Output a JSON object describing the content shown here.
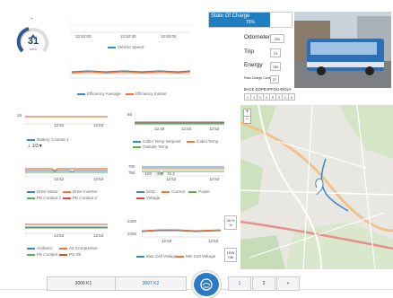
{
  "gauge": {
    "value": "31",
    "unit": "km/h"
  },
  "speed_chart": {
    "ticks": [
      "12:52:00",
      "12:52:30",
      "12:53:00"
    ],
    "legend": "Vehicle Speed"
  },
  "eff_chart": {
    "legend": [
      "Efficiency Average",
      "Efficiency Instant"
    ]
  },
  "soc": {
    "label": "State Of Charge",
    "value": "76%"
  },
  "odometer": {
    "label": "Odometer",
    "value": "200"
  },
  "trip": {
    "label": "Trip",
    "value": "74"
  },
  "energy": {
    "label": "Energy",
    "value": "780"
  },
  "pass_charge": {
    "label": "Pass Charge Current",
    "value": "27"
  },
  "batt": {
    "label": "BACK DOPEAPFOU+ROU+",
    "cells": [
      "1",
      "1",
      "1",
      "1",
      "0",
      "2",
      "1",
      "0"
    ]
  },
  "chart3": {
    "ytick": "18",
    "ticks": [
      "12:52",
      "12:53"
    ],
    "legend": [
      "Battery Coolant 1"
    ],
    "arrows": "⊥ 1/3▼"
  },
  "chart4": {
    "ytick": "50",
    "ticks": [
      "12:48",
      "12:50",
      "12:52"
    ],
    "legend": [
      "Cabin Temp Setpoint",
      "Cabin Temp",
      "Outside Temp"
    ]
  },
  "chart5": {
    "ticks": [
      "12:52",
      "12:53"
    ],
    "legend": [
      "Drive Motor",
      "Drive Inverter",
      "PE Coolant 1",
      "PE Coolant 2"
    ]
  },
  "chart6": {
    "yticks": [
      "700",
      "750"
    ],
    "xticks": [
      "-100",
      "-300",
      "76.2"
    ],
    "ticks": [
      "12:52",
      "12:53"
    ],
    "legend": [
      "SOC",
      "Current",
      "Power",
      "Voltage"
    ]
  },
  "chart7": {
    "ticks": [
      "12:52",
      "12:53"
    ],
    "legend": [
      "Ambient",
      "Air Compressor",
      "PE Coolant",
      "PS Oil"
    ]
  },
  "chart8": {
    "yticks": [
      "2400",
      "2200"
    ],
    "ticks": [
      "12:50",
      "12:52"
    ],
    "legend": [
      "Max Cell Voltage",
      "Min Cell Voltage"
    ]
  },
  "side_boxes": {
    "a": "28 %\n%",
    "b": "1KW\n74k"
  },
  "map_controls": {
    "zoom_in": "+",
    "zoom_out": "−"
  },
  "tabs": {
    "t1": "3006 K1",
    "t2": "3007 K2",
    "p1": "1",
    "p2": "2",
    "add": "+"
  }
}
